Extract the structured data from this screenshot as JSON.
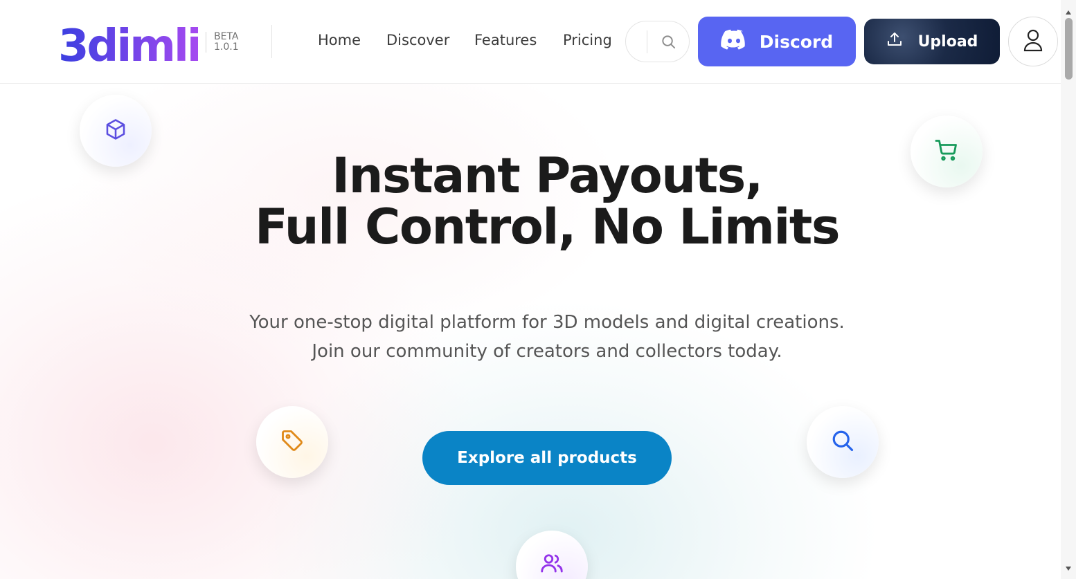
{
  "brand": {
    "logo_text": "3dimli",
    "beta_label": "BETA",
    "version": "1.0.1"
  },
  "nav": {
    "items": [
      {
        "label": "Home"
      },
      {
        "label": "Discover"
      },
      {
        "label": "Features"
      },
      {
        "label": "Pricing"
      }
    ]
  },
  "header": {
    "search_icon": "search-icon",
    "discord_label": "Discord",
    "upload_label": "Upload",
    "avatar_icon": "user-icon"
  },
  "hero": {
    "title_line1": "Instant Payouts,",
    "title_line2": "Full Control, No Limits",
    "subtitle_line1": "Your one-stop digital platform for 3D models and digital creations.",
    "subtitle_line2": "Join our community of creators and collectors today.",
    "cta_label": "Explore all products",
    "floating_icons": [
      "cube-icon",
      "cart-icon",
      "tag-icon",
      "search-icon",
      "users-icon"
    ]
  },
  "colors": {
    "discord": "#5865f2",
    "cta": "#0a84c6",
    "upload": "#1b2a47",
    "logo_start": "#3b3fe0",
    "logo_end": "#a64af0"
  }
}
